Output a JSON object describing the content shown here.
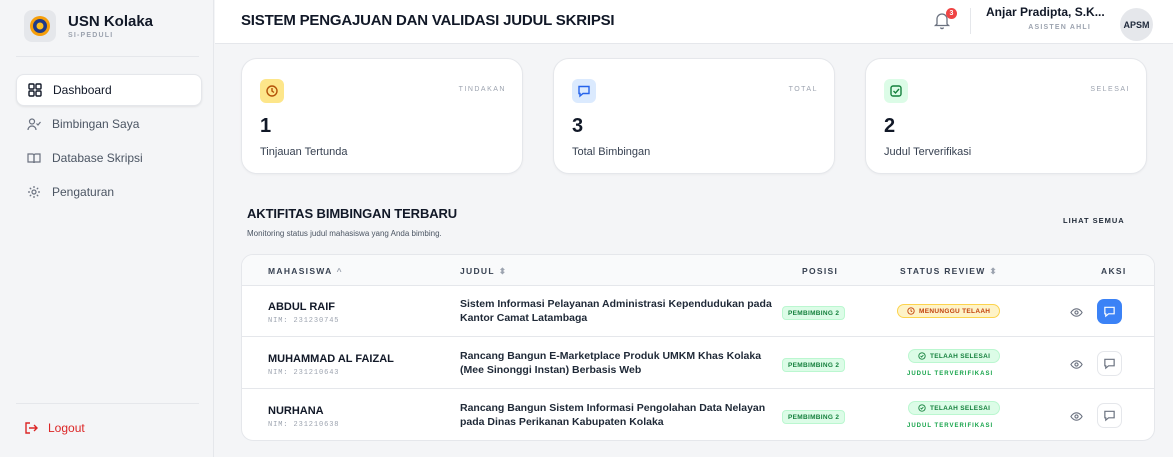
{
  "brand": {
    "name": "USN Kolaka",
    "sub": "SI-PEDULI"
  },
  "sidebar": {
    "items": [
      {
        "label": "Dashboard",
        "icon": "dashboard-icon",
        "active": true
      },
      {
        "label": "Bimbingan Saya",
        "icon": "users-icon",
        "active": false
      },
      {
        "label": "Database Skripsi",
        "icon": "book-icon",
        "active": false
      },
      {
        "label": "Pengaturan",
        "icon": "gear-icon",
        "active": false
      }
    ],
    "logout_label": "Logout"
  },
  "header": {
    "title": "SISTEM PENGAJUAN DAN VALIDASI JUDUL SKRIPSI",
    "notification_count": "3",
    "user_name": "Anjar Pradipta, S.K...",
    "user_role": "ASISTEN AHLI",
    "avatar_initials": "APSM"
  },
  "stats": [
    {
      "tag": "TINDAKAN",
      "value": "1",
      "label": "Tinjauan Tertunda",
      "icon": "clock-icon",
      "color": "#fde68a"
    },
    {
      "tag": "TOTAL",
      "value": "3",
      "label": "Total Bimbingan",
      "icon": "chat-icon",
      "color": "#dbeafe"
    },
    {
      "tag": "SELESAI",
      "value": "2",
      "label": "Judul Terverifikasi",
      "icon": "checkbox-icon",
      "color": "#dcfce7"
    }
  ],
  "activity": {
    "title": "AKTIFITAS BIMBINGAN TERBARU",
    "subtitle": "Monitoring status judul mahasiswa yang Anda bimbing.",
    "see_all": "LIHAT SEMUA",
    "columns": {
      "mahasiswa": "MAHASISWA",
      "judul": "JUDUL",
      "posisi": "POSISI",
      "status": "STATUS REVIEW",
      "aksi": "AKSI"
    },
    "sort_asc": "^",
    "sort_both": "⬍",
    "rows": [
      {
        "name": "ABDUL RAIF",
        "nim": "NIM: 231230745",
        "title": "Sistem Informasi Pelayanan Administrasi Kependudukan pada Kantor Camat Latambaga",
        "position": "PEMBIMBING 2",
        "status": "MENUNGGU TELAAH",
        "status_type": "pending",
        "verified": ""
      },
      {
        "name": "MUHAMMAD AL FAIZAL",
        "nim": "NIM: 231210643",
        "title": "Rancang Bangun E-Marketplace Produk UMKM Khas Kolaka (Mee Sinonggi Instan) Berbasis Web",
        "position": "PEMBIMBING 2",
        "status": "TELAAH SELESAI",
        "status_type": "done",
        "verified": "JUDUL TERVERIFIKASI"
      },
      {
        "name": "NURHANA",
        "nim": "NIM: 231210638",
        "title": "Rancang Bangun Sistem Informasi Pengolahan Data Nelayan pada Dinas Perikanan Kabupaten Kolaka",
        "position": "PEMBIMBING 2",
        "status": "TELAAH SELESAI",
        "status_type": "done",
        "verified": "JUDUL TERVERIFIKASI"
      }
    ]
  },
  "colors": {
    "accent": "#3b82f6",
    "danger": "#dc2626",
    "success": "#15803d",
    "warning": "#c2410c"
  }
}
